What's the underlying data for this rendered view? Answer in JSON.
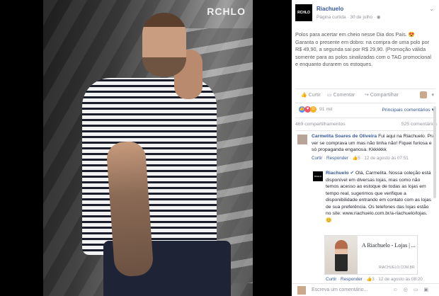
{
  "photo": {
    "logo": "RCHLO"
  },
  "post": {
    "page_logo_text": "RCHLO",
    "page_name": "Riachuelo",
    "meta": "Página curtida · 30 de julho · ",
    "text": "Polos para acertar em cheio nesse Dia dos Pais. 😍 Garanta o presente em dobro: na compra de uma polo por R$ 49,90, a segunda sai por R$ 29,90. (Promoção válida somente para as polos sinalizadas com o TAG promocional e enquanto durarem os estoques."
  },
  "actions": {
    "like": "Curtir",
    "comment": "Comentar",
    "share": "Compartilhar"
  },
  "reactions": {
    "count": "91 mil",
    "sort": "Principais comentários ▾"
  },
  "stats": {
    "shares": "469 compartilhamentos",
    "comments": "525 comentários"
  },
  "comments": [
    {
      "author": "Carmelita Soares de Oliveira",
      "text": "Fui aqui na Riachuelo. Pra ver se comprava um mas não tinha não! Fiquei furiosa e só propaganda enganosa. Kkkkkkk",
      "like": "Curtir",
      "reply": "Responder",
      "reactions": "5",
      "time": "12 de agosto às 07:51"
    },
    {
      "author": "Riachuelo",
      "text": "Olá, Carmelita. Nossa coleção está disponível em diversas lojas, mas como não temos acesso ao estoque de todas as lojas em tempo real, sugerimos que verifique a disponibilidade entrando em contato com as lojas de sua preferência. Os telefones das lojas estão no site: www.riachuelo.com.br/a-riachuelo/lojas. 😊",
      "like": "Curtir",
      "reply": "Responder",
      "reactions": "3",
      "time": "12 de agosto às 08:20"
    }
  ],
  "link_card": {
    "title": "A Riachuelo - Lojas | ...",
    "url": "RIACHUELO.COM.BR"
  },
  "composer": {
    "placeholder": "Escreva um comentário...",
    "icons": "☺ ◎ ▭ ▣"
  }
}
